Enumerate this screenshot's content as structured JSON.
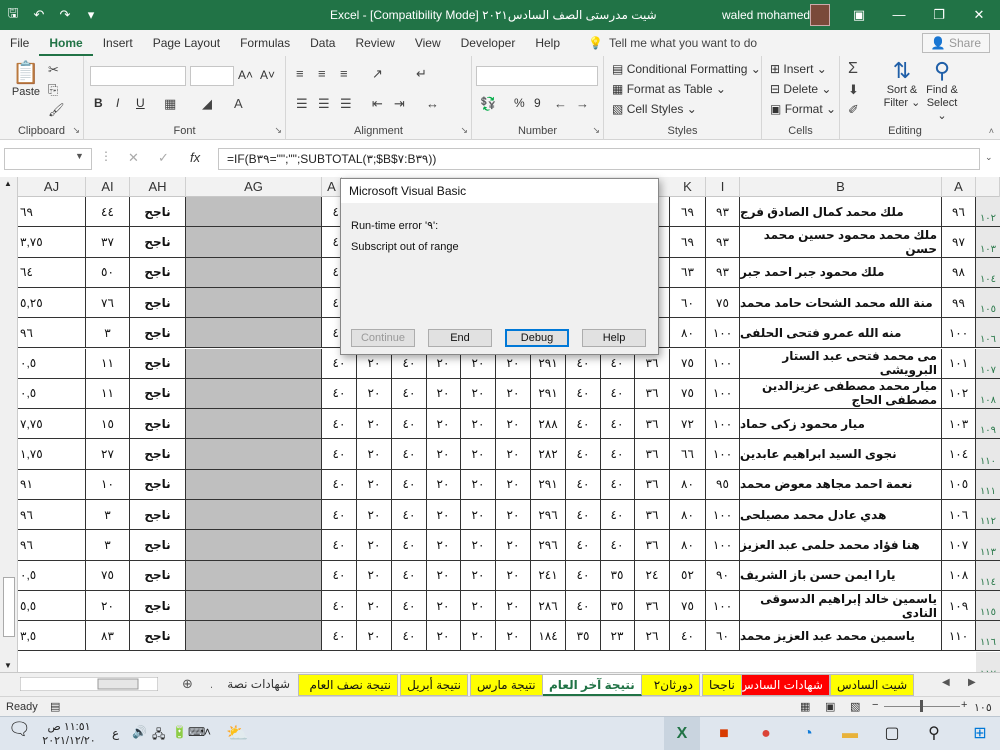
{
  "window": {
    "title": "شيت مدرستى الصف السادس٢٠٢١  [Compatibility Mode]  -  Excel",
    "user": "waled mohamed"
  },
  "quick_access": {
    "save_icon": "save-icon",
    "undo_icon": "undo-icon",
    "redo_icon": "redo-icon"
  },
  "ribbon_tabs": [
    "File",
    "Home",
    "Insert",
    "Page Layout",
    "Formulas",
    "Data",
    "Review",
    "View",
    "Developer",
    "Help"
  ],
  "active_tab": "Home",
  "tell_me": "Tell me what you want to do",
  "share": "Share",
  "ribbon": {
    "clipboard": {
      "label": "Clipboard",
      "paste": "Paste"
    },
    "font": {
      "label": "Font",
      "bold": "B",
      "italic": "I",
      "underline": "U",
      "grow": "A˄",
      "shrink": "A˅"
    },
    "alignment": {
      "label": "Alignment"
    },
    "number": {
      "label": "Number",
      "percent": "%",
      "comma": "9"
    },
    "styles": {
      "label": "Styles",
      "conditional": "Conditional Formatting",
      "format_table": "Format as Table",
      "cell_styles": "Cell Styles"
    },
    "cells": {
      "label": "Cells",
      "insert": "Insert",
      "delete": "Delete",
      "format": "Format"
    },
    "editing": {
      "label": "Editing",
      "sort": "Sort &",
      "filter": "Filter",
      "find": "Find &",
      "select": "Select"
    }
  },
  "formula_bar": {
    "formula": "=IF(B٣٩=\"\";\"\";SUBTOTAL(٣;$B$٧:B٣٩))"
  },
  "columns": [
    {
      "key": "aj",
      "label": "AJ"
    },
    {
      "key": "ai",
      "label": "AI"
    },
    {
      "key": "ah",
      "label": "AH"
    },
    {
      "key": "ag",
      "label": "AG"
    },
    {
      "key": "a_hidden",
      "label": "A"
    },
    {
      "key": "k",
      "label": "K"
    },
    {
      "key": "i",
      "label": "I"
    },
    {
      "key": "b",
      "label": "B"
    },
    {
      "key": "a",
      "label": "A"
    }
  ],
  "rows": [
    {
      "rh": "١٠٢",
      "a": "٩٦",
      "b": "ملك محمد كمال الصادق فرج",
      "i": "٩٣",
      "k": "٦٩",
      "mid": [
        "٤٠",
        "",
        "",
        "",
        "",
        "",
        "",
        "",
        "",
        ""
      ],
      "ah": "ناجح",
      "ai": "٤٤",
      "aj": "٦٩"
    },
    {
      "rh": "١٠٣",
      "a": "٩٧",
      "b": "ملك محمد محمود حسين محمد حسن",
      "i": "٩٣",
      "k": "٦٩",
      "mid": [
        "٤٠",
        "",
        "",
        "",
        "",
        "",
        "",
        "",
        "",
        ""
      ],
      "ah": "ناجح",
      "ai": "٣٧",
      "aj": "٣,٧٥"
    },
    {
      "rh": "١٠٤",
      "a": "٩٨",
      "b": "ملك محمود جبر احمد جبر",
      "i": "٩٣",
      "k": "٦٣",
      "mid": [
        "٤٠",
        "",
        "",
        "",
        "",
        "",
        "",
        "",
        "",
        ""
      ],
      "ah": "ناجح",
      "ai": "٥٠",
      "aj": "٦٤"
    },
    {
      "rh": "١٠٥",
      "a": "٩٩",
      "b": "منة الله محمد الشحات حامد محمد",
      "i": "٧٥",
      "k": "٦٠",
      "mid": [
        "٤٠",
        "",
        "",
        "",
        "",
        "",
        "",
        "",
        "",
        ""
      ],
      "ah": "ناجح",
      "ai": "٧٦",
      "aj": "٥,٢٥"
    },
    {
      "rh": "١٠٦",
      "a": "١٠٠",
      "b": "منه الله عمرو فتحى الحلفى",
      "i": "١٠٠",
      "k": "٨٠",
      "mid": [
        "٤٠",
        "",
        "",
        "",
        "",
        "",
        "",
        "",
        "",
        ""
      ],
      "ah": "ناجح",
      "ai": "٣",
      "aj": "٩٦"
    },
    {
      "rh": "١٠٧",
      "a": "١٠١",
      "b": "مى محمد فتحى عبد الستار البرويشى",
      "i": "١٠٠",
      "k": "٧٥",
      "mid": [
        "٤٠",
        "٢٠",
        "٤٠",
        "٢٠",
        "٢٠",
        "٢٠",
        "٢٩١",
        "٤٠",
        "٤٠",
        "٣٦"
      ],
      "ah": "ناجح",
      "ai": "١١",
      "aj": "٠,٥"
    },
    {
      "rh": "١٠٨",
      "a": "١٠٢",
      "b": "ميار محمد مصطفى عزيزالدين مصطفى الحاج",
      "i": "١٠٠",
      "k": "٧٥",
      "mid": [
        "٤٠",
        "٢٠",
        "٤٠",
        "٢٠",
        "٢٠",
        "٢٠",
        "٢٩١",
        "٤٠",
        "٤٠",
        "٣٦"
      ],
      "ah": "ناجح",
      "ai": "١١",
      "aj": "٠,٥"
    },
    {
      "rh": "١٠٩",
      "a": "١٠٣",
      "b": "ميار محمود زكى حماد",
      "i": "١٠٠",
      "k": "٧٢",
      "mid": [
        "٤٠",
        "٢٠",
        "٤٠",
        "٢٠",
        "٢٠",
        "٢٠",
        "٢٨٨",
        "٤٠",
        "٤٠",
        "٣٦"
      ],
      "ah": "ناجح",
      "ai": "١٥",
      "aj": "٧,٧٥"
    },
    {
      "rh": "١١٠",
      "a": "١٠٤",
      "b": "نجوى السيد ابراهيم عابدين",
      "i": "١٠٠",
      "k": "٦٦",
      "mid": [
        "٤٠",
        "٢٠",
        "٤٠",
        "٢٠",
        "٢٠",
        "٢٠",
        "٢٨٢",
        "٤٠",
        "٤٠",
        "٣٦"
      ],
      "ah": "ناجح",
      "ai": "٢٧",
      "aj": "١,٧٥"
    },
    {
      "rh": "١١١",
      "a": "١٠٥",
      "b": "نعمة احمد مجاهد معوض محمد",
      "i": "٩٥",
      "k": "٨٠",
      "mid": [
        "٤٠",
        "٢٠",
        "٤٠",
        "٢٠",
        "٢٠",
        "٢٠",
        "٢٩١",
        "٤٠",
        "٤٠",
        "٣٦"
      ],
      "ah": "ناجح",
      "ai": "١٠",
      "aj": "٩١"
    },
    {
      "rh": "١١٢",
      "a": "١٠٦",
      "b": "هدي عادل محمد مصيلحى",
      "i": "١٠٠",
      "k": "٨٠",
      "mid": [
        "٤٠",
        "٢٠",
        "٤٠",
        "٢٠",
        "٢٠",
        "٢٠",
        "٢٩٦",
        "٤٠",
        "٤٠",
        "٣٦"
      ],
      "ah": "ناجح",
      "ai": "٣",
      "aj": "٩٦"
    },
    {
      "rh": "١١٣",
      "a": "١٠٧",
      "b": "هنا فؤاد محمد حلمى عبد العزيز",
      "i": "١٠٠",
      "k": "٨٠",
      "mid": [
        "٤٠",
        "٢٠",
        "٤٠",
        "٢٠",
        "٢٠",
        "٢٠",
        "٢٩٦",
        "٤٠",
        "٤٠",
        "٣٦"
      ],
      "ah": "ناجح",
      "ai": "٣",
      "aj": "٩٦"
    },
    {
      "rh": "١١٤",
      "a": "١٠٨",
      "b": "يارا ايمن حسن باز الشريف",
      "i": "٩٠",
      "k": "٥٢",
      "mid": [
        "٤٠",
        "٢٠",
        "٤٠",
        "٢٠",
        "٢٠",
        "٢٠",
        "٢٤١",
        "٤٠",
        "٣٥",
        "٢٤"
      ],
      "ah": "ناجح",
      "ai": "٧٥",
      "aj": "٠,٥"
    },
    {
      "rh": "١١٥",
      "a": "١٠٩",
      "b": "ياسمين خالد إبراهيم الدسوقى النادى",
      "i": "١٠٠",
      "k": "٧٥",
      "mid": [
        "٤٠",
        "٢٠",
        "٤٠",
        "٢٠",
        "٢٠",
        "٢٠",
        "٢٨٦",
        "٤٠",
        "٣٥",
        "٣٦"
      ],
      "ah": "ناجح",
      "ai": "٢٠",
      "aj": "٥,٥"
    },
    {
      "rh": "١١٦",
      "a": "١١٠",
      "b": "ياسمين محمد عبد العزيز محمد",
      "i": "٦٠",
      "k": "٤٠",
      "mid": [
        "٤٠",
        "٢٠",
        "٤٠",
        "٢٠",
        "٢٠",
        "٢٠",
        "١٨٤",
        "٣٥",
        "٢٣",
        "٢٦"
      ],
      "ah": "ناجح",
      "ai": "٨٣",
      "aj": "٣,٥"
    }
  ],
  "last_row_header": "١١٧",
  "dialog": {
    "title": "Microsoft Visual Basic",
    "error": "Run-time error '٩':",
    "message": "Subscript out of range",
    "buttons": {
      "continue": "Continue",
      "end": "End",
      "debug": "Debug",
      "help": "Help"
    }
  },
  "sheet_tabs": [
    {
      "label": "شيت السادس",
      "style": "yellow"
    },
    {
      "label": "شهادات السادس",
      "style": "red"
    },
    {
      "label": "ناجحا",
      "style": "yellow"
    },
    {
      "label": "دورثان٢",
      "style": "yellow"
    },
    {
      "label": "نتيجة آخر العام",
      "style": "active"
    },
    {
      "label": "نتيجة مارس",
      "style": "yellow"
    },
    {
      "label": "نتيجة أبريل",
      "style": "yellow"
    },
    {
      "label": "نتيجة نصف العام",
      "style": "yellow"
    },
    {
      "label": "شهادات نصة",
      "style": "plain"
    }
  ],
  "sheet_more": "...",
  "status": {
    "ready": "Ready",
    "zoom": "١٠٥"
  },
  "clock": {
    "time": "١١:٥١ ص",
    "date": "٢٠٢١/١٢/٢٠",
    "lang": "ع"
  },
  "colors": {
    "excel_green": "#217346",
    "tab_yellow": "#ffff00",
    "tab_red": "#ff0000",
    "gray_fill": "#bfbfbf"
  }
}
